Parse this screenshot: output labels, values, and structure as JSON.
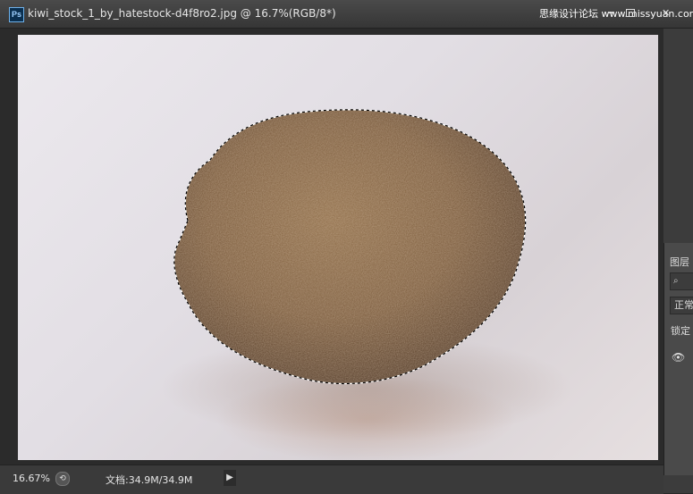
{
  "window": {
    "app_icon_label": "Ps",
    "title": "kiwi_stock_1_by_hatestock-d4f8ro2.jpg @ 16.7%(RGB/8*)",
    "watermark": "思缘设计论坛 www.missyuan.com",
    "minimize_glyph": "━",
    "close_glyph": "✕"
  },
  "status": {
    "zoom": "16.67%",
    "doc_info": "文档:34.9M/34.9M",
    "icon_glyph": "⟲",
    "menu_arrow": "▶"
  },
  "layers_panel": {
    "tab_label": "图层",
    "search_icon_glyph": "⌕",
    "blend_mode": "正常",
    "lock_label": "锁定",
    "eye_glyph": "👁"
  },
  "colors": {
    "background": "#3c3c3c",
    "canvas_bg": "#2b2b2b",
    "kiwi_brown": "#7a5a3a"
  }
}
